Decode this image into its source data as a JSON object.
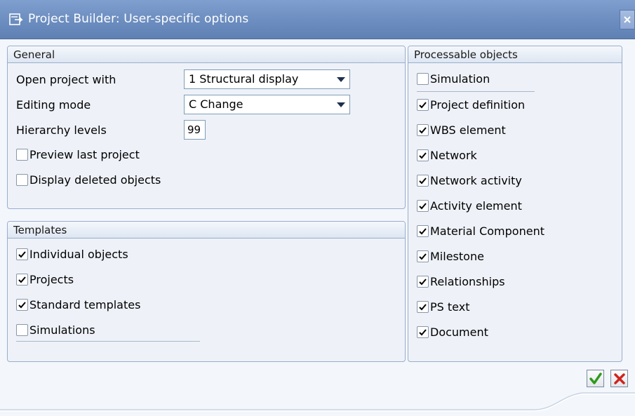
{
  "window": {
    "title": "Project Builder: User-specific options"
  },
  "general": {
    "header": "General",
    "open_project_label": "Open project with",
    "open_project_value": "1 Structural display",
    "editing_mode_label": "Editing mode",
    "editing_mode_value": "C Change",
    "hierarchy_label": "Hierarchy levels",
    "hierarchy_value": "99",
    "preview_last_label": "Preview last project",
    "preview_last_checked": false,
    "display_deleted_label": "Display deleted objects",
    "display_deleted_checked": false
  },
  "templates": {
    "header": "Templates",
    "items": [
      {
        "label": "Individual objects",
        "checked": true
      },
      {
        "label": "Projects",
        "checked": true
      },
      {
        "label": "Standard templates",
        "checked": true
      },
      {
        "label": "Simulations",
        "checked": false
      }
    ]
  },
  "processable": {
    "header": "Processable objects",
    "items": [
      {
        "label": "Simulation",
        "checked": false
      },
      {
        "label": "Project definition",
        "checked": true
      },
      {
        "label": "WBS element",
        "checked": true
      },
      {
        "label": "Network",
        "checked": true
      },
      {
        "label": "Network activity",
        "checked": true
      },
      {
        "label": "Activity element",
        "checked": true
      },
      {
        "label": "Material Component",
        "checked": true
      },
      {
        "label": "Milestone",
        "checked": true
      },
      {
        "label": "Relationships",
        "checked": true
      },
      {
        "label": "PS text",
        "checked": true
      },
      {
        "label": "Document",
        "checked": true
      }
    ]
  },
  "footer": {
    "ok_icon": "check-icon",
    "cancel_icon": "x-icon"
  },
  "colors": {
    "titlebar": "#6f90c2",
    "ok_green": "#2e9a1a",
    "cancel_red": "#d0221b"
  }
}
